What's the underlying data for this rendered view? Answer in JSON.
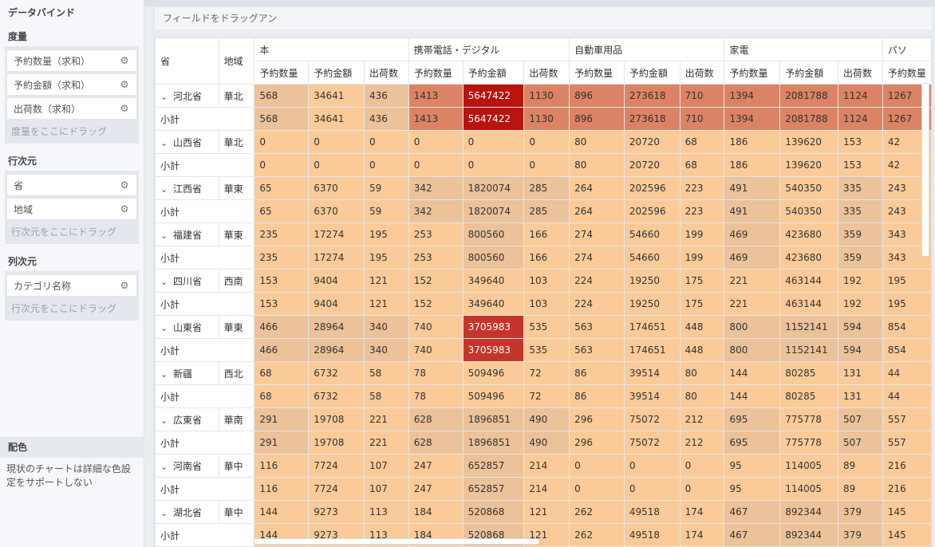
{
  "sidebar": {
    "title": "データバインド",
    "measures": {
      "heading": "度量",
      "fields": [
        "予約数量（求和）",
        "予約金額（求和）",
        "出荷数（求和）"
      ],
      "drop_hint": "度量をここにドラッグ"
    },
    "rows": {
      "heading": "行次元",
      "fields": [
        "省",
        "地域"
      ],
      "drop_hint": "行次元をここにドラッグ"
    },
    "columns": {
      "heading": "列次元",
      "fields": [
        "カテゴリ名称"
      ],
      "drop_hint": "行次元をここにドラッグ"
    },
    "color": {
      "heading": "配色",
      "note": "現状のチャートは詳細な色設定をサポートしない"
    }
  },
  "toolbar": {
    "drop_placeholder": "フィールドをドラッグアン"
  },
  "table": {
    "row_headers": [
      "省",
      "地域"
    ],
    "categories": [
      "本",
      "携帯電話・デジタル",
      "自動車用品",
      "家電",
      "パソ"
    ],
    "measures": [
      "予約数量",
      "予約金額",
      "出荷数"
    ],
    "subtotal_label": "小計",
    "provinces": [
      {
        "name": "河北省",
        "region": "華北",
        "values": [
          "568",
          "34641",
          "436",
          "1413",
          "5647422",
          "1130",
          "896",
          "273618",
          "710",
          "1394",
          "2081788",
          "1124",
          "1267"
        ],
        "levels": [
          1,
          0,
          1,
          3,
          5,
          3,
          3,
          3,
          3,
          3,
          3,
          3,
          3
        ]
      },
      {
        "name": "山西省",
        "region": "華北",
        "values": [
          "0",
          "0",
          "0",
          "0",
          "0",
          "0",
          "80",
          "20720",
          "68",
          "186",
          "139620",
          "153",
          "42"
        ],
        "levels": [
          0,
          0,
          0,
          0,
          0,
          0,
          0,
          0,
          0,
          0,
          0,
          0,
          0
        ]
      },
      {
        "name": "江西省",
        "region": "華東",
        "values": [
          "65",
          "6370",
          "59",
          "342",
          "1820074",
          "285",
          "264",
          "202596",
          "223",
          "491",
          "540350",
          "335",
          "243"
        ],
        "levels": [
          0,
          0,
          0,
          1,
          1,
          1,
          0,
          0,
          0,
          1,
          0,
          1,
          0
        ]
      },
      {
        "name": "福建省",
        "region": "華東",
        "values": [
          "235",
          "17274",
          "195",
          "253",
          "800560",
          "166",
          "274",
          "54660",
          "199",
          "469",
          "423680",
          "359",
          "343"
        ],
        "levels": [
          0,
          0,
          0,
          0,
          1,
          0,
          0,
          0,
          0,
          1,
          0,
          1,
          0
        ]
      },
      {
        "name": "四川省",
        "region": "西南",
        "values": [
          "153",
          "9404",
          "121",
          "152",
          "349640",
          "103",
          "224",
          "19250",
          "175",
          "221",
          "463144",
          "192",
          "195"
        ],
        "levels": [
          0,
          0,
          0,
          0,
          0,
          0,
          0,
          0,
          0,
          0,
          0,
          0,
          0
        ]
      },
      {
        "name": "山東省",
        "region": "華東",
        "values": [
          "466",
          "28964",
          "340",
          "740",
          "3705983",
          "535",
          "563",
          "174651",
          "448",
          "800",
          "1152141",
          "594",
          "854"
        ],
        "levels": [
          1,
          1,
          1,
          0,
          4,
          0,
          0,
          0,
          0,
          1,
          1,
          1,
          0
        ]
      },
      {
        "name": "新疆",
        "region": "西北",
        "values": [
          "68",
          "6732",
          "58",
          "78",
          "509496",
          "72",
          "86",
          "39514",
          "80",
          "144",
          "80285",
          "131",
          "44"
        ],
        "levels": [
          0,
          0,
          0,
          0,
          0,
          0,
          0,
          0,
          0,
          0,
          0,
          0,
          0
        ]
      },
      {
        "name": "広東省",
        "region": "華南",
        "values": [
          "291",
          "19708",
          "221",
          "628",
          "1896851",
          "490",
          "296",
          "75072",
          "212",
          "695",
          "775778",
          "507",
          "557"
        ],
        "levels": [
          1,
          0,
          0,
          1,
          1,
          1,
          0,
          0,
          0,
          1,
          0,
          1,
          0
        ]
      },
      {
        "name": "河南省",
        "region": "華中",
        "values": [
          "116",
          "7724",
          "107",
          "247",
          "652857",
          "214",
          "0",
          "0",
          "0",
          "95",
          "114005",
          "89",
          "216"
        ],
        "levels": [
          0,
          0,
          0,
          0,
          1,
          0,
          0,
          0,
          0,
          0,
          0,
          0,
          0
        ]
      },
      {
        "name": "湖北省",
        "region": "華中",
        "values": [
          "144",
          "9273",
          "113",
          "184",
          "520868",
          "121",
          "262",
          "49518",
          "174",
          "467",
          "892344",
          "379",
          "145"
        ],
        "levels": [
          0,
          0,
          0,
          0,
          1,
          0,
          0,
          0,
          0,
          1,
          1,
          1,
          0
        ]
      }
    ]
  },
  "colors": {
    "heat_low": "#facb98",
    "heat_mid_low": "#ecc29a",
    "heat_mid": "#db8364",
    "heat_high": "#c6352a",
    "heat_max": "#b8130c"
  }
}
